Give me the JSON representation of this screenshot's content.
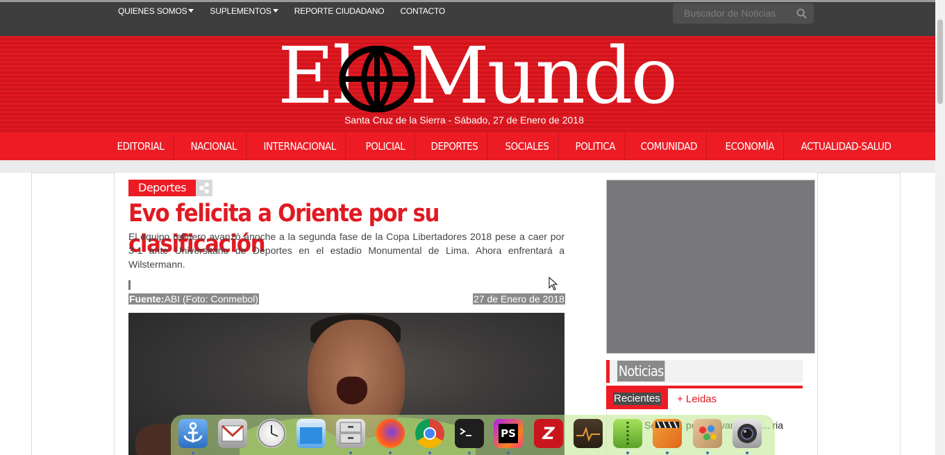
{
  "topnav": {
    "items": [
      {
        "label": "QUIENES SOMOS",
        "dropdown": true
      },
      {
        "label": "SUPLEMENTOS",
        "dropdown": true
      },
      {
        "label": "REPORTE CIUDADANO",
        "dropdown": false
      },
      {
        "label": "CONTACTO",
        "dropdown": false
      }
    ],
    "search_placeholder": "Buscador de Noticias"
  },
  "header": {
    "logo_part1": "El",
    "logo_part2": "Mundo",
    "dateline": "Santa Cruz de la Sierra - Sábado, 27 de Enero de 2018"
  },
  "mainnav": {
    "items": [
      "EDITORIAL",
      "NACIONAL",
      "INTERNACIONAL",
      "POLICIAL",
      "DEPORTES",
      "SOCIALES",
      "POLITICA",
      "COMUNIDAD",
      "ECONOMÍA",
      "ACTUALIDAD-SALUD"
    ]
  },
  "article": {
    "category": "Deportes",
    "title": "Evo felicita a Oriente por su clasificación",
    "lead": "El equipo refinero avanzó anoche a la segunda fase de la Copa Libertadores 2018 pese a caer por 3-1 ante Universitario de Deportes en el estadio Monumental de Lima. Ahora enfrentará a Wilstermann.",
    "source_label": "Fuente:",
    "source_value": "ABI (Foto: Conmebol)",
    "date": "27 de Enero de 2018"
  },
  "sidebar": {
    "section_title": "Noticias",
    "tab_recent": "Recientes",
    "tab_read": "+ Leidas",
    "news_partial": "Sé... a ... pe... Cavani ... ac... ria"
  },
  "dock": {
    "apps": [
      "anchor-app",
      "mail-app",
      "clock-app",
      "finder-app",
      "files-app",
      "firefox",
      "chrome",
      "terminal",
      "phpstorm",
      "filezilla",
      "activity-monitor",
      "archive-manager",
      "video-editor",
      "paint-app",
      "camera-app"
    ]
  },
  "colors": {
    "brand_red": "#ed1c24",
    "topbar": "#3e3e3e",
    "highlight_gray": "#8a8a8a"
  }
}
